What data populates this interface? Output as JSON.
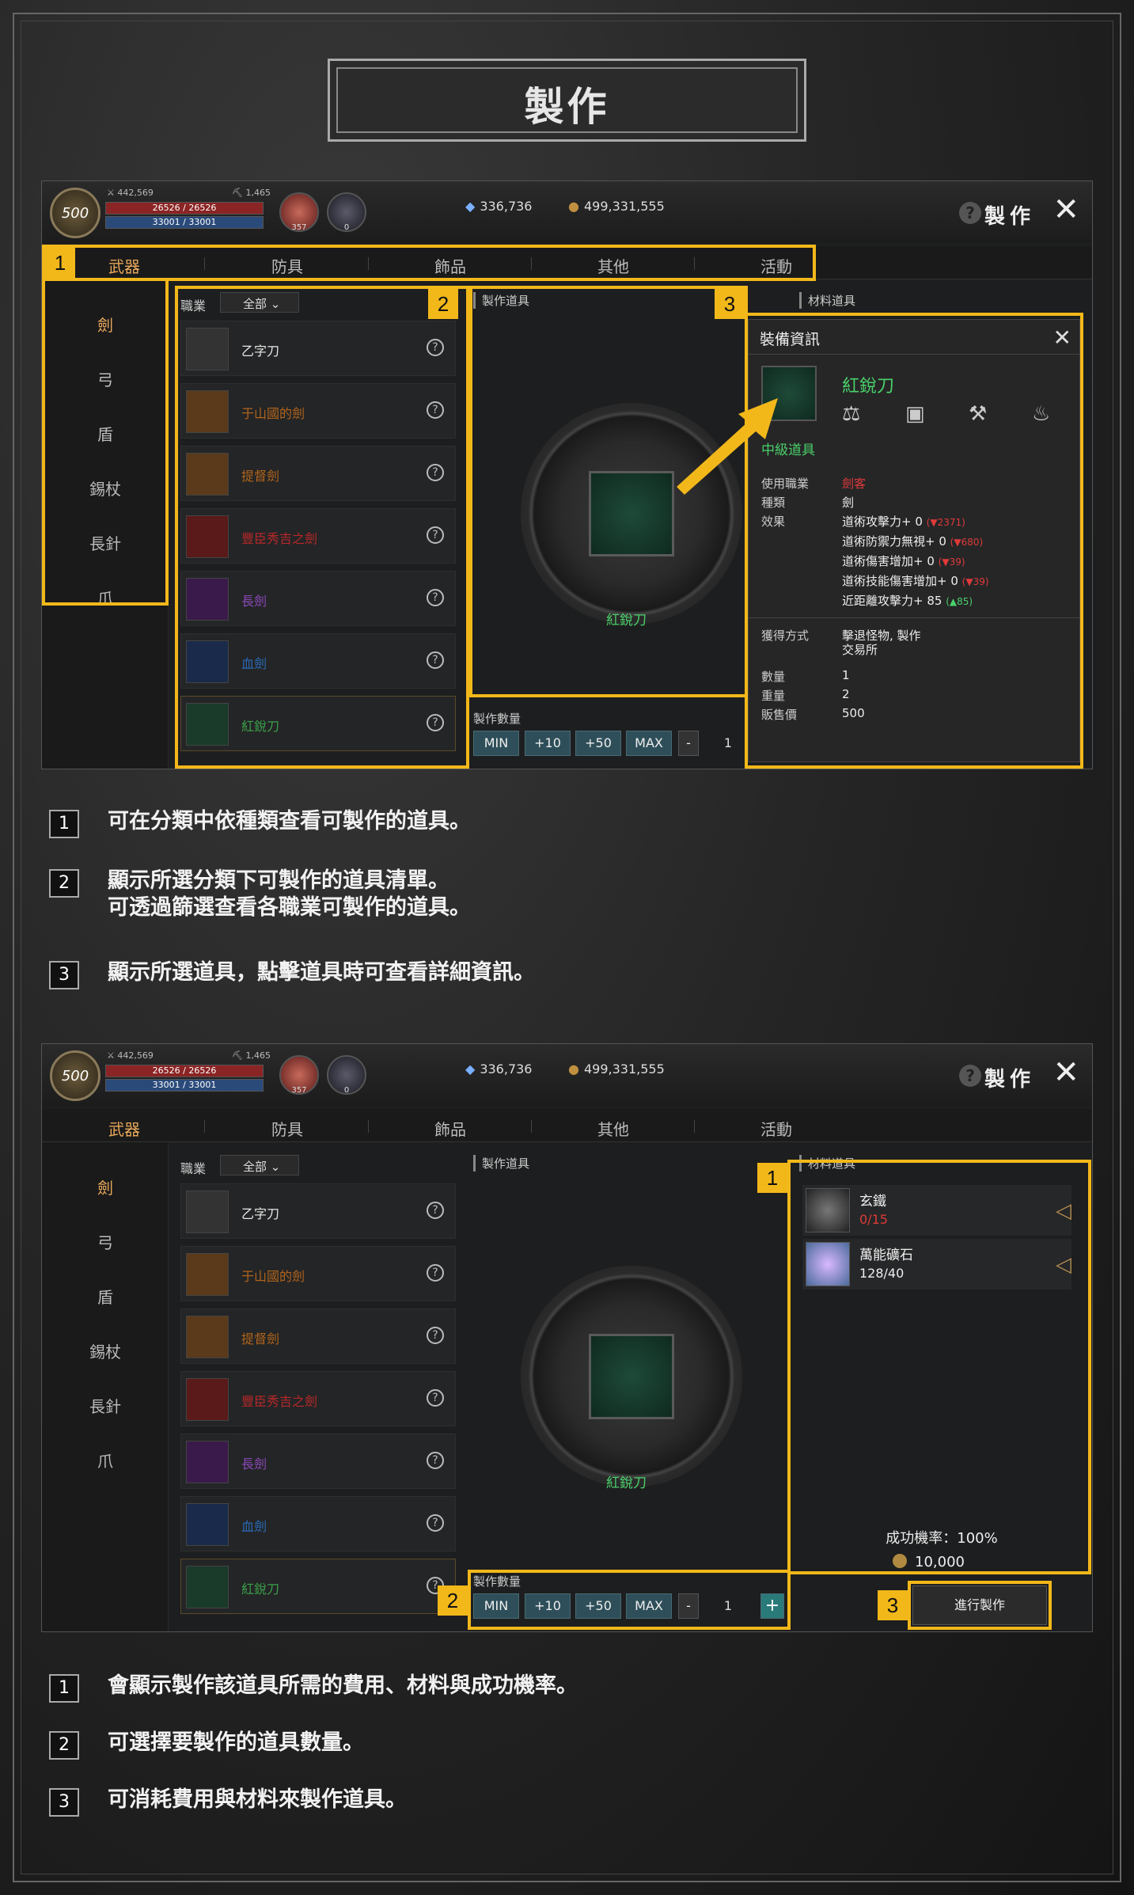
{
  "page_title": "製作",
  "hud": {
    "level": "500",
    "stat_attack": "442,569",
    "stat_pick": "1,465",
    "hp": "26526 / 26526",
    "mp": "33001 / 33001",
    "potion_count": "357",
    "potion2_count": "0",
    "gems": "336,736",
    "gold": "499,331,555",
    "window_title": "製作"
  },
  "tabs": [
    "武器",
    "防具",
    "飾品",
    "其他",
    "活動"
  ],
  "sidebar": [
    "劍",
    "弓",
    "盾",
    "錫杖",
    "長針",
    "爪"
  ],
  "filter": {
    "label": "職業",
    "value": "全部"
  },
  "items": [
    {
      "name": "乙字刀",
      "color": "#e6e6e6"
    },
    {
      "name": "于山國的劍",
      "color": "#b0641c"
    },
    {
      "name": "提督劍",
      "color": "#b0641c"
    },
    {
      "name": "豐臣秀吉之劍",
      "color": "#b8282a"
    },
    {
      "name": "長劍",
      "color": "#8a48b8"
    },
    {
      "name": "血劍",
      "color": "#2a6ab8"
    },
    {
      "name": "紅銳刀",
      "color": "#3aa04a"
    }
  ],
  "craft": {
    "header": "製作道具",
    "item_name": "紅銳刀",
    "qty_label": "製作數量",
    "btn_min": "MIN",
    "btn_p10": "+10",
    "btn_p50": "+50",
    "btn_max": "MAX",
    "btn_minus": "-",
    "qty": "1",
    "btn_plus": "+"
  },
  "materials": {
    "header": "材料道具",
    "list": [
      {
        "name": "玄鐵",
        "count": "0/15",
        "color": "#e03a3a"
      },
      {
        "name": "萬能礦石",
        "count": "128/40",
        "color": "#eeeeee"
      }
    ],
    "rate": "成功機率：100%",
    "cost": "10,000",
    "go_button": "進行製作"
  },
  "info": {
    "title": "裝備資訊",
    "name": "紅銳刀",
    "grade": "中級道具",
    "rows": [
      {
        "k": "使用職業",
        "v": "劍客",
        "cls": "red"
      },
      {
        "k": "種類",
        "v": "劍",
        "cls": ""
      },
      {
        "k": "效果",
        "v": "道術攻擊力+ 0",
        "delta": "(▼2371)",
        "dcls": "red"
      },
      {
        "k": "",
        "v": "道術防禦力無視+ 0",
        "delta": "(▼680)",
        "dcls": "red"
      },
      {
        "k": "",
        "v": "道術傷害增加+ 0",
        "delta": "(▼39)",
        "dcls": "red"
      },
      {
        "k": "",
        "v": "道術技能傷害增加+ 0",
        "delta": "(▼39)",
        "dcls": "red"
      },
      {
        "k": "",
        "v": "近距離攻擊力+ 85",
        "delta": "(▲85)",
        "dcls": "grn"
      }
    ],
    "acquire_label": "獲得方式",
    "acquire_1": "擊退怪物, 製作",
    "acquire_2": "交易所",
    "qty_label": "數量",
    "qty": "1",
    "weight_label": "重量",
    "weight": "2",
    "price_label": "販售價",
    "price": "500"
  },
  "markers": [
    "1",
    "2",
    "3"
  ],
  "desc1": [
    "可在分類中依種類查看可製作的道具。",
    "顯示所選分類下可製作的道具清單。",
    "可透過篩選查看各職業可製作的道具。",
    "顯示所選道具，點擊道具時可查看詳細資訊。"
  ],
  "desc2": [
    "會顯示製作該道具所需的費用、材料與成功機率。",
    "可選擇要製作的道具數量。",
    "可消耗費用與材料來製作道具。"
  ],
  "colors": {
    "highlight": "#f2b81a",
    "rare_green": "#4ad06a",
    "tab_active": "#e8a85a"
  }
}
